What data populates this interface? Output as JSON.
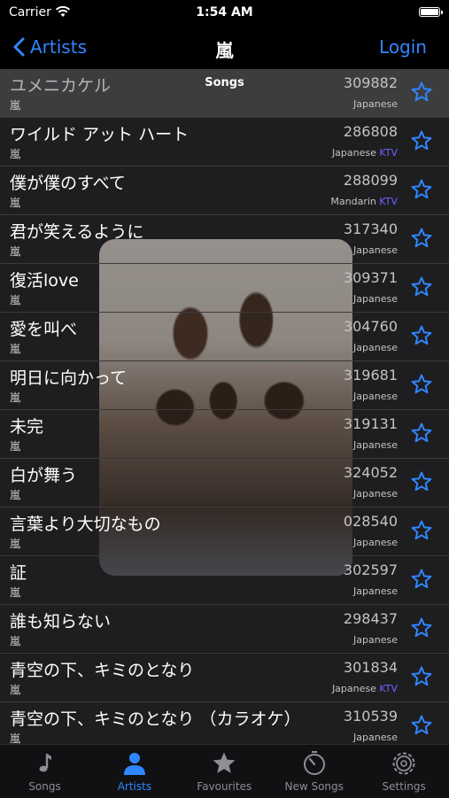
{
  "status": {
    "carrier": "Carrier",
    "time": "1:54 AM"
  },
  "nav": {
    "back_label": "Artists",
    "title": "嵐",
    "login_label": "Login"
  },
  "section_header": "Songs",
  "songs": [
    {
      "title": "ユメニカケル",
      "artist": "嵐",
      "code": "309882",
      "language": "Japanese",
      "ktv": ""
    },
    {
      "title": "ワイルド アット ハート",
      "artist": "嵐",
      "code": "286808",
      "language": "Japanese",
      "ktv": "KTV"
    },
    {
      "title": "僕が僕のすべて",
      "artist": "嵐",
      "code": "288099",
      "language": "Mandarin",
      "ktv": "KTV"
    },
    {
      "title": "君が笑えるように",
      "artist": "嵐",
      "code": "317340",
      "language": "Japanese",
      "ktv": ""
    },
    {
      "title": "復活love",
      "artist": "嵐",
      "code": "309371",
      "language": "Japanese",
      "ktv": ""
    },
    {
      "title": "愛を叫べ",
      "artist": "嵐",
      "code": "304760",
      "language": "Japanese",
      "ktv": ""
    },
    {
      "title": "明日に向かって",
      "artist": "嵐",
      "code": "319681",
      "language": "Japanese",
      "ktv": ""
    },
    {
      "title": "未完",
      "artist": "嵐",
      "code": "319131",
      "language": "Japanese",
      "ktv": ""
    },
    {
      "title": "白が舞う",
      "artist": "嵐",
      "code": "324052",
      "language": "Japanese",
      "ktv": ""
    },
    {
      "title": "言葉より大切なもの",
      "artist": "嵐",
      "code": "028540",
      "language": "Japanese",
      "ktv": ""
    },
    {
      "title": "証",
      "artist": "嵐",
      "code": "302597",
      "language": "Japanese",
      "ktv": ""
    },
    {
      "title": "誰も知らない",
      "artist": "嵐",
      "code": "298437",
      "language": "Japanese",
      "ktv": ""
    },
    {
      "title": "青空の下、キミのとなり",
      "artist": "嵐",
      "code": "301834",
      "language": "Japanese",
      "ktv": "KTV"
    },
    {
      "title": "青空の下、キミのとなり （カラオケ）",
      "artist": "嵐",
      "code": "310539",
      "language": "Japanese",
      "ktv": ""
    }
  ],
  "tabs": [
    {
      "label": "Songs",
      "icon": "music-note-icon",
      "active": false
    },
    {
      "label": "Artists",
      "icon": "person-icon",
      "active": true
    },
    {
      "label": "Favourites",
      "icon": "star-icon",
      "active": false
    },
    {
      "label": "New Songs",
      "icon": "stopwatch-icon",
      "active": false
    },
    {
      "label": "Settings",
      "icon": "gear-icon",
      "active": false
    }
  ],
  "colors": {
    "accent": "#2f87ff",
    "ktv": "#6b63ff",
    "background": "#1c1c1e"
  }
}
